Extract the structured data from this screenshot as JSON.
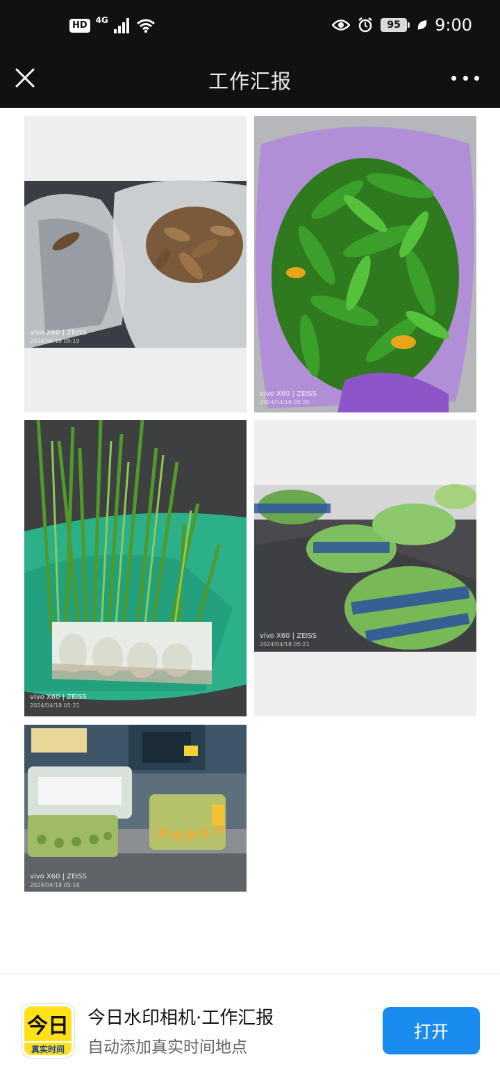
{
  "status_bar": {
    "hd_label": "HD",
    "network_label": "4G",
    "battery_level": "95",
    "time": "9:00"
  },
  "header": {
    "title": "工作汇报"
  },
  "photos": [
    {
      "watermark_brand": "vivo X60 | ZEISS",
      "watermark_date": "2024/04/18 05:19"
    },
    {
      "watermark_brand": "vivo X60 | ZEISS",
      "watermark_date": "2024/04/18 05:20"
    },
    {
      "watermark_brand": "vivo X60 | ZEISS",
      "watermark_date": "2024/04/18 05:21"
    },
    {
      "watermark_brand": "vivo X60 | ZEISS",
      "watermark_date": "2024/04/18 05:21"
    },
    {
      "watermark_brand": "vivo X60 | ZEISS",
      "watermark_date": "2024/04/18 05:18"
    }
  ],
  "banner": {
    "icon_glyph": "今日",
    "icon_caption": "真实时间",
    "app_name": "今日水印相机·工作汇报",
    "app_desc": "自动添加真实时间地点",
    "open_label": "打开"
  },
  "colors": {
    "bar_background": "#111111",
    "button_blue": "#1a8cf0",
    "icon_yellow": "#ffe11a"
  }
}
